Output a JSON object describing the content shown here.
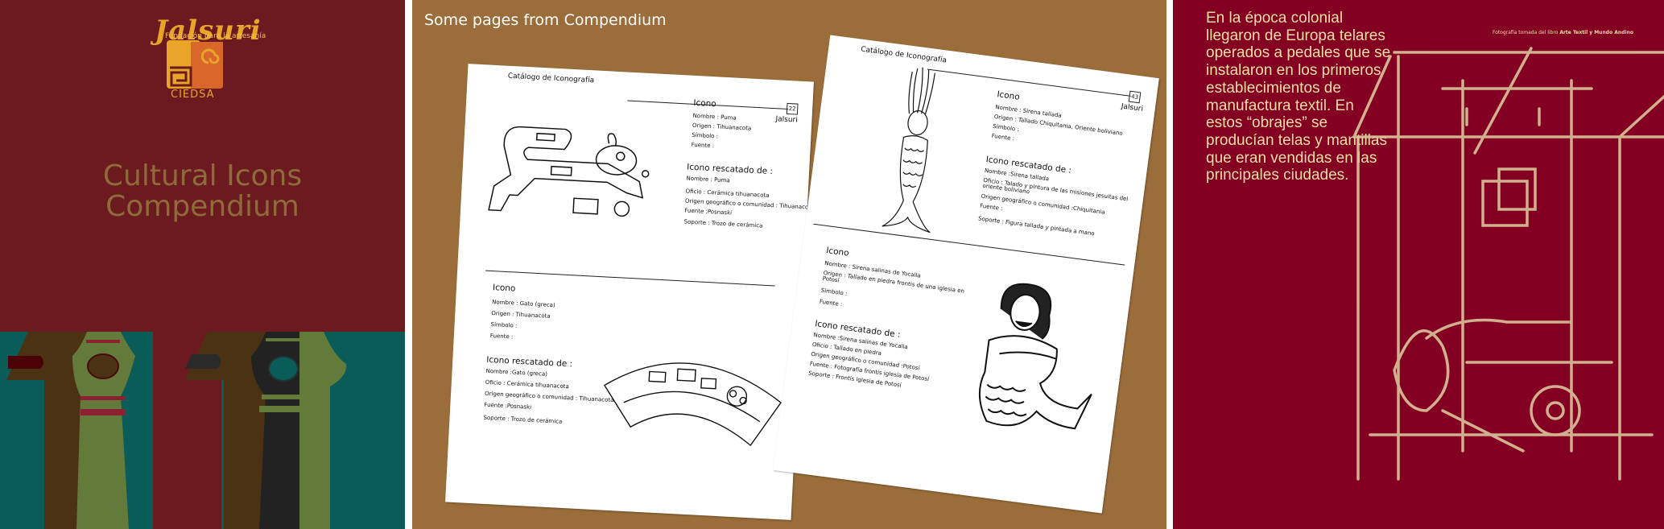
{
  "cover": {
    "logo_word": "Jalsuri",
    "logo_subtitle": "Fundación para la artesanía",
    "logo_org": "CIEDSA",
    "title_line1": "Cultural Icons",
    "title_line2": "Compendium",
    "colors": {
      "background": "#6b1a20",
      "title": "#8f6b3a",
      "band": "#0a5c58"
    }
  },
  "pages_panel": {
    "title": "Some pages from Compendium",
    "background": "#9a6d3a",
    "pages": [
      {
        "header": "Catálogo de Iconografía",
        "page_number": "22",
        "brand": "Jalsuri",
        "top": {
          "icono_heading": "Icono",
          "icono_fields": [
            "Nombre : Puma",
            "Origen : Tihuanacota",
            "Símbolo :",
            "Fuente :"
          ],
          "rescatado_heading": "Icono rescatado de :",
          "rescatado_fields": [
            "Nombre :  Puma",
            "Oficio : Cerámica tihuanacota",
            "Origen geográfico o comunidad : Tihuanacota",
            "Fuente :Posnaski",
            "Soporte : Trozo de cerámica"
          ]
        },
        "bottom": {
          "icono_heading": "Icono",
          "icono_fields": [
            "Nombre : Gato (greca)",
            "Origen : Tihuanacota",
            "Símbolo :",
            "Fuente :"
          ],
          "rescatado_heading": "Icono rescatado de :",
          "rescatado_fields": [
            "Nombre :Gato (greca)",
            "Oficio : Cerámica tihuanacota",
            "Origen geográfico o comunidad : Tihuanacota",
            "Fuente :Posnaski",
            "Soporte : Trozo de cerámica"
          ]
        }
      },
      {
        "header": "Catálogo de Iconografía",
        "page_number": "43",
        "brand": "Jalsuri",
        "top": {
          "icono_heading": "Icono",
          "icono_fields": [
            "Nombre : Sirena tallada",
            "Origen : Tallado Chiquitania, Oriente boliviano",
            "Símbolo :",
            "Fuente :"
          ],
          "rescatado_heading": "Icono rescatado de :",
          "rescatado_fields": [
            "Nombre :Sirena tallada",
            "Oficio : Talado y pintura de las misiones jesuitas del",
            "oriente boliviano",
            "Origen geográfico o comunidad :Chiquitania",
            "Fuente :",
            "Soporte : Figura tallada y pintada a mano"
          ]
        },
        "bottom": {
          "icono_heading": "Icono",
          "icono_fields": [
            "Nombre : Sirena salinas de Yocalla",
            "Origen : Tallado en piedra frontis de una iglesia en",
            "Potosí",
            "Símbolo :",
            "Fuente :"
          ],
          "rescatado_heading": "Icono rescatado de :",
          "rescatado_fields": [
            "Nombre :Sirena salinas de Yocalla",
            "Oficio :  Tallado en piedra",
            "Origen geográfico o comunidad :Potosí",
            "Fuente : Fotografía frontis iglesia de Potosí",
            "Soporte : Frontis iglesia de Potosí"
          ]
        }
      }
    ]
  },
  "textile_panel": {
    "text": "En la época colonial llegaron de Europa telares operados a pedales que se instalaron en los primeros establecimientos de manufactura textil. En estos “obrajes” se producían telas y mantillas que eran vendidas en las principales ciudades.",
    "caption_prefix": "Fotografía tomada del libro ",
    "caption_book": "Arte Textil y Mundo Andino",
    "colors": {
      "background": "#840023",
      "text": "#f2dfa6"
    }
  }
}
